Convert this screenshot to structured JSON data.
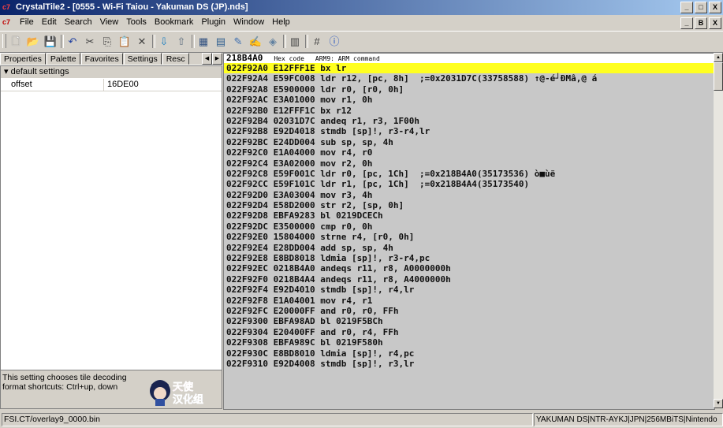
{
  "window": {
    "title": "CrystalTile2 - [0555 - Wi-Fi Taiou - Yakuman DS (JP).nds]",
    "app_icon": "ct-logo-icon",
    "buttons": [
      "_",
      "□",
      "X"
    ],
    "mdi_buttons": [
      "_",
      "B",
      "X"
    ]
  },
  "menu": {
    "items": [
      "File",
      "Edit",
      "Search",
      "View",
      "Tools",
      "Bookmark",
      "Plugin",
      "Window",
      "Help"
    ]
  },
  "toolbar": {
    "icons": [
      "new-file-icon",
      "open-folder-icon",
      "save-icon",
      "undo-icon",
      "cut-icon",
      "copy-icon",
      "paste-icon",
      "delete-icon",
      "import-icon",
      "export-icon",
      "image-icon",
      "rom-icon",
      "edit-icon",
      "text-icon",
      "palette-icon",
      "layout-icon",
      "grid-icon",
      "help-icon"
    ]
  },
  "left": {
    "tabs": [
      "Properties",
      "Palette",
      "Favorites",
      "Settings",
      "Resc"
    ],
    "group": "default settings",
    "rows": [
      {
        "key": "offset",
        "value": "16DE00"
      }
    ],
    "help_text": "This setting chooses tile decoding format shortcuts: Ctrl+up, down",
    "logo_text": "天使汉化组"
  },
  "code": {
    "header_addr": "218B4A0",
    "header_hex": "Hex code",
    "header_cmd": "ARM9: ARM command",
    "lines": [
      "022F92A0 E12FFF1E bx lr",
      "022F92A4 E59FC008 ldr r12, [pc, 8h]  ;=0x2031D7C(33758588) ↑@-é┘ÐMâ,@ á",
      "022F92A8 E5900000 ldr r0, [r0, 0h]",
      "022F92AC E3A01000 mov r1, 0h",
      "022F92B0 E12FFF1C bx r12",
      "022F92B4 02031D7C andeq r1, r3, 1F00h",
      "022F92B8 E92D4018 stmdb [sp]!, r3-r4,lr",
      "022F92BC E24DD004 sub sp, sp, 4h",
      "022F92C0 E1A04000 mov r4, r0",
      "022F92C4 E3A02000 mov r2, 0h",
      "022F92C8 E59F001C ldr r0, [pc, 1Ch]  ;=0x218B4A0(35173536) ò■ùë",
      "022F92CC E59F101C ldr r1, [pc, 1Ch]  ;=0x218B4A4(35173540)",
      "022F92D0 E3A03004 mov r3, 4h",
      "022F92D4 E58D2000 str r2, [sp, 0h]",
      "022F92D8 EBFA9283 bl 0219DCECh",
      "022F92DC E3500000 cmp r0, 0h",
      "022F92E0 15804000 strne r4, [r0, 0h]",
      "022F92E4 E28DD004 add sp, sp, 4h",
      "022F92E8 E8BD8018 ldmia [sp]!, r3-r4,pc",
      "022F92EC 0218B4A0 andeqs r11, r8, A0000000h",
      "022F92F0 0218B4A4 andeqs r11, r8, A4000000h",
      "022F92F4 E92D4010 stmdb [sp]!, r4,lr",
      "022F92F8 E1A04001 mov r4, r1",
      "022F92FC E20000FF and r0, r0, FFh",
      "022F9300 EBFA98AD bl 0219F5BCh",
      "022F9304 E20400FF and r0, r4, FFh",
      "022F9308 EBFA989C bl 0219F580h",
      "022F930C E8BD8010 ldmia [sp]!, r4,pc",
      "022F9310 E92D4008 stmdb [sp]!, r3,lr"
    ],
    "selected_index": 0
  },
  "status": {
    "file": "FSI.CT/overlay9_0000.bin",
    "rom_info": "YAKUMAN DS|NTR-AYKJ|JPN|256MBiTS|Nintendo"
  }
}
